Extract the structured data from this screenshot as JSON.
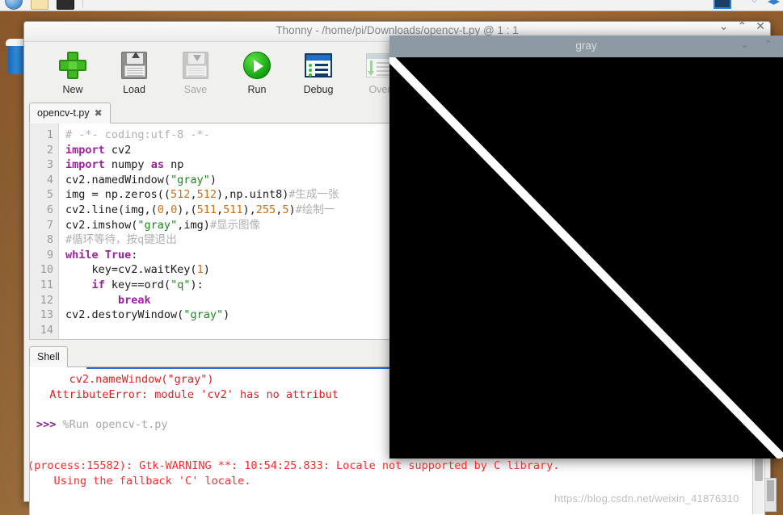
{
  "panel": {
    "left_icons": [
      "globe-icon",
      "folder-icon",
      "terminal-icon"
    ],
    "right_icons": [
      "vlc-icon",
      "bluetooth-icon",
      "volume-icon",
      "network-icon"
    ]
  },
  "desktop": {
    "trash_label": "Trash"
  },
  "thonny": {
    "title": "Thonny  -  /home/pi/Downloads/opencv-t.py  @  1 : 1",
    "window_controls": {
      "minimize": "⌄",
      "maximize": "⌃",
      "close": "✕"
    },
    "toolbar": [
      {
        "label": "New",
        "icon": "plus-icon",
        "disabled": false
      },
      {
        "label": "Load",
        "icon": "load-icon",
        "disabled": false
      },
      {
        "label": "Save",
        "icon": "save-icon",
        "disabled": true
      },
      {
        "label": "Run",
        "icon": "play-icon",
        "disabled": false
      },
      {
        "label": "Debug",
        "icon": "debug-icon",
        "disabled": false
      },
      {
        "label": "Over",
        "icon": "step-over-icon",
        "disabled": true
      }
    ],
    "editor_tab": {
      "label": "opencv-t.py",
      "close": "✖"
    },
    "line_numbers": [
      "1",
      "2",
      "3",
      "4",
      "5",
      "6",
      "7",
      "8",
      "9",
      "10",
      "11",
      "12",
      "13",
      "14"
    ],
    "code_lines": [
      [
        {
          "t": "# -*- coding:utf-8 -*-",
          "c": "c"
        }
      ],
      [
        {
          "t": "import",
          "c": "k"
        },
        {
          "t": " cv2",
          "c": ""
        }
      ],
      [
        {
          "t": "import",
          "c": "k"
        },
        {
          "t": " numpy ",
          "c": ""
        },
        {
          "t": "as",
          "c": "k"
        },
        {
          "t": " np",
          "c": ""
        }
      ],
      [
        {
          "t": "cv2.namedWindow(",
          "c": ""
        },
        {
          "t": "\"gray\"",
          "c": "s"
        },
        {
          "t": ")",
          "c": ""
        }
      ],
      [
        {
          "t": "img = np.zeros((",
          "c": ""
        },
        {
          "t": "512",
          "c": "n"
        },
        {
          "t": ",",
          "c": ""
        },
        {
          "t": "512",
          "c": "n"
        },
        {
          "t": "),np.uint8)",
          "c": ""
        },
        {
          "t": "#生成一张",
          "c": "c"
        }
      ],
      [
        {
          "t": "cv2.line(img,(",
          "c": ""
        },
        {
          "t": "0",
          "c": "n"
        },
        {
          "t": ",",
          "c": ""
        },
        {
          "t": "0",
          "c": "n"
        },
        {
          "t": "),(",
          "c": ""
        },
        {
          "t": "511",
          "c": "n"
        },
        {
          "t": ",",
          "c": ""
        },
        {
          "t": "511",
          "c": "n"
        },
        {
          "t": "),",
          "c": ""
        },
        {
          "t": "255",
          "c": "n"
        },
        {
          "t": ",",
          "c": ""
        },
        {
          "t": "5",
          "c": "n"
        },
        {
          "t": ")",
          "c": ""
        },
        {
          "t": "#绘制一",
          "c": "c"
        }
      ],
      [
        {
          "t": "cv2.imshow(",
          "c": ""
        },
        {
          "t": "\"gray\"",
          "c": "s"
        },
        {
          "t": ",img)",
          "c": ""
        },
        {
          "t": "#显示图像",
          "c": "c"
        }
      ],
      [
        {
          "t": "#循环等待，按q键退出",
          "c": "c"
        }
      ],
      [
        {
          "t": "while",
          "c": "k"
        },
        {
          "t": " ",
          "c": ""
        },
        {
          "t": "True",
          "c": "k"
        },
        {
          "t": ":",
          "c": ""
        }
      ],
      [
        {
          "t": "    key=cv2.waitKey(",
          "c": ""
        },
        {
          "t": "1",
          "c": "n"
        },
        {
          "t": ")",
          "c": ""
        }
      ],
      [
        {
          "t": "    ",
          "c": ""
        },
        {
          "t": "if",
          "c": "k"
        },
        {
          "t": " key==ord(",
          "c": ""
        },
        {
          "t": "\"q\"",
          "c": "s"
        },
        {
          "t": "):",
          "c": ""
        }
      ],
      [
        {
          "t": "        ",
          "c": ""
        },
        {
          "t": "break",
          "c": "k"
        }
      ],
      [
        {
          "t": "cv2.destoryWindow(",
          "c": ""
        },
        {
          "t": "\"gray\"",
          "c": "s"
        },
        {
          "t": ")",
          "c": ""
        }
      ],
      [
        {
          "t": "",
          "c": ""
        }
      ]
    ],
    "shell_tab": {
      "label": "Shell"
    },
    "shell_lines": [
      {
        "text": "     cv2.nameWindow(\"gray\")",
        "style": "err"
      },
      {
        "text": "  AttributeError: module 'cv2' has no attribut",
        "style": "err"
      },
      {
        "text": "",
        "style": "plain"
      },
      {
        "text": "__PROMPT__",
        "style": "prompt",
        "prompt": ">>> ",
        "command": "%Run opencv-t.py"
      }
    ]
  },
  "cv_window": {
    "title": "gray",
    "controls": {
      "minimize": "⌄",
      "maximize": "⌃"
    },
    "canvas": {
      "background": "#000000",
      "line_color": "#ffffff",
      "line_from": [
        0,
        0
      ],
      "line_to": [
        511,
        511
      ],
      "thickness": 5
    }
  },
  "terminal_warning": {
    "lines": [
      "(process:15582): Gtk-WARNING **: 10:54:25.833: Locale not supported by C library.",
      "    Using the fallback 'C' locale."
    ],
    "color": "#ff2a2a"
  },
  "watermark": {
    "text": "https://blog.csdn.net/weixin_41876310"
  },
  "colors": {
    "accent_blue": "#2b6fd6",
    "error_red": "#e22020",
    "keyword_purple": "#a021a0",
    "string_green": "#1a8a1a",
    "number_orange": "#cc6f19",
    "comment_gray": "#b0b0b0",
    "cv_titlebar": "#8d9aa3"
  }
}
